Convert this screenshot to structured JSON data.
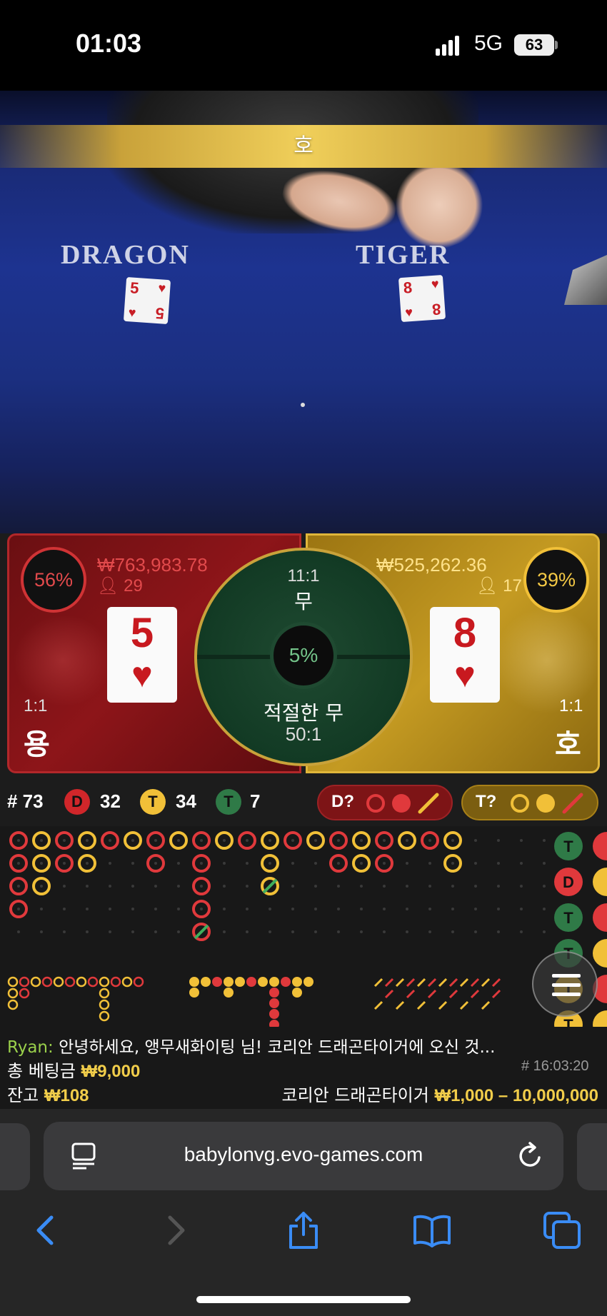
{
  "status_bar": {
    "time": "01:03",
    "network": "5G",
    "battery": "63"
  },
  "video": {
    "banner": "호",
    "table_left_label": "DRAGON",
    "table_right_label": "TIGER",
    "dragon_card": {
      "rank": "5",
      "suit": "♥"
    },
    "tiger_card": {
      "rank": "8",
      "suit": "♥"
    }
  },
  "dragon": {
    "percent": "56%",
    "amount": "₩763,983.78",
    "players": "29",
    "card_rank": "5",
    "card_suit": "♥",
    "odds": "1:1",
    "name": "용"
  },
  "tiger": {
    "percent": "39%",
    "amount": "₩525,262.36",
    "players": "17",
    "card_rank": "8",
    "card_suit": "♥",
    "odds": "1:1",
    "name": "호"
  },
  "tie": {
    "odds": "11:1",
    "label": "무",
    "percent": "5%",
    "suited_label": "적절한 무",
    "suited_odds": "50:1"
  },
  "stats": {
    "round": "# 73",
    "dragon_badge": "D",
    "dragon_count": "32",
    "tiger_badge": "T",
    "tiger_count": "34",
    "tie_badge": "T",
    "tie_count": "7"
  },
  "predictions": {
    "dragon_label": "D?",
    "tiger_label": "T?"
  },
  "side_road": [
    "T",
    "D",
    "T",
    "T",
    "T",
    "T"
  ],
  "chat": {
    "user": "Ryan:",
    "message": " 안녕하세요, 앵무새화이팅 님! 코리안 드래곤타이거에 오신 것..."
  },
  "info": {
    "time": "# 16:03:20",
    "bet_label": "총 베팅금",
    "bet_value": "₩9,000",
    "balance_label": "잔고",
    "balance_value": "₩108",
    "table_name": "코리안 드래곤타이거",
    "limits": "₩1,000 – 10,000,000"
  },
  "browser": {
    "url": "babylonvg.evo-games.com"
  },
  "colors": {
    "dragon": "#b2272a",
    "tiger": "#e0b63a",
    "tie": "#2f7a47",
    "accent": "#f1cd4a"
  }
}
